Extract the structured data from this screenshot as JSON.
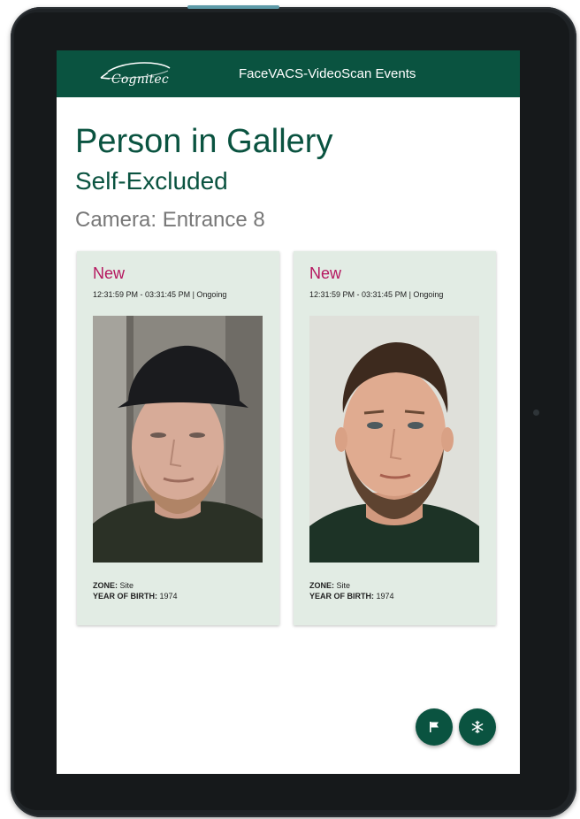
{
  "header": {
    "logo_text": "Cognitec",
    "title": "FaceVACS-VideoScan Events"
  },
  "main": {
    "title": "Person in Gallery",
    "subtitle": "Self-Excluded",
    "camera": "Camera: Entrance 8"
  },
  "cards": [
    {
      "status": "New",
      "time": "12:31:59 PM - 03:31:45 PM | Ongoing",
      "zone_label": "ZONE:",
      "zone_value": "Site",
      "yob_label": "YEAR OF BIRTH:",
      "yob_value": "1974"
    },
    {
      "status": "New",
      "time": "12:31:59 PM - 03:31:45 PM | Ongoing",
      "zone_label": "ZONE:",
      "zone_value": "Site",
      "yob_label": "YEAR OF BIRTH:",
      "yob_value": "1974"
    }
  ],
  "actions": {
    "flag_icon": "flag-icon",
    "freeze_icon": "snowflake-icon"
  },
  "colors": {
    "brand_green": "#0a5340",
    "status_new": "#b5175f",
    "card_background": "#e2ece4"
  }
}
